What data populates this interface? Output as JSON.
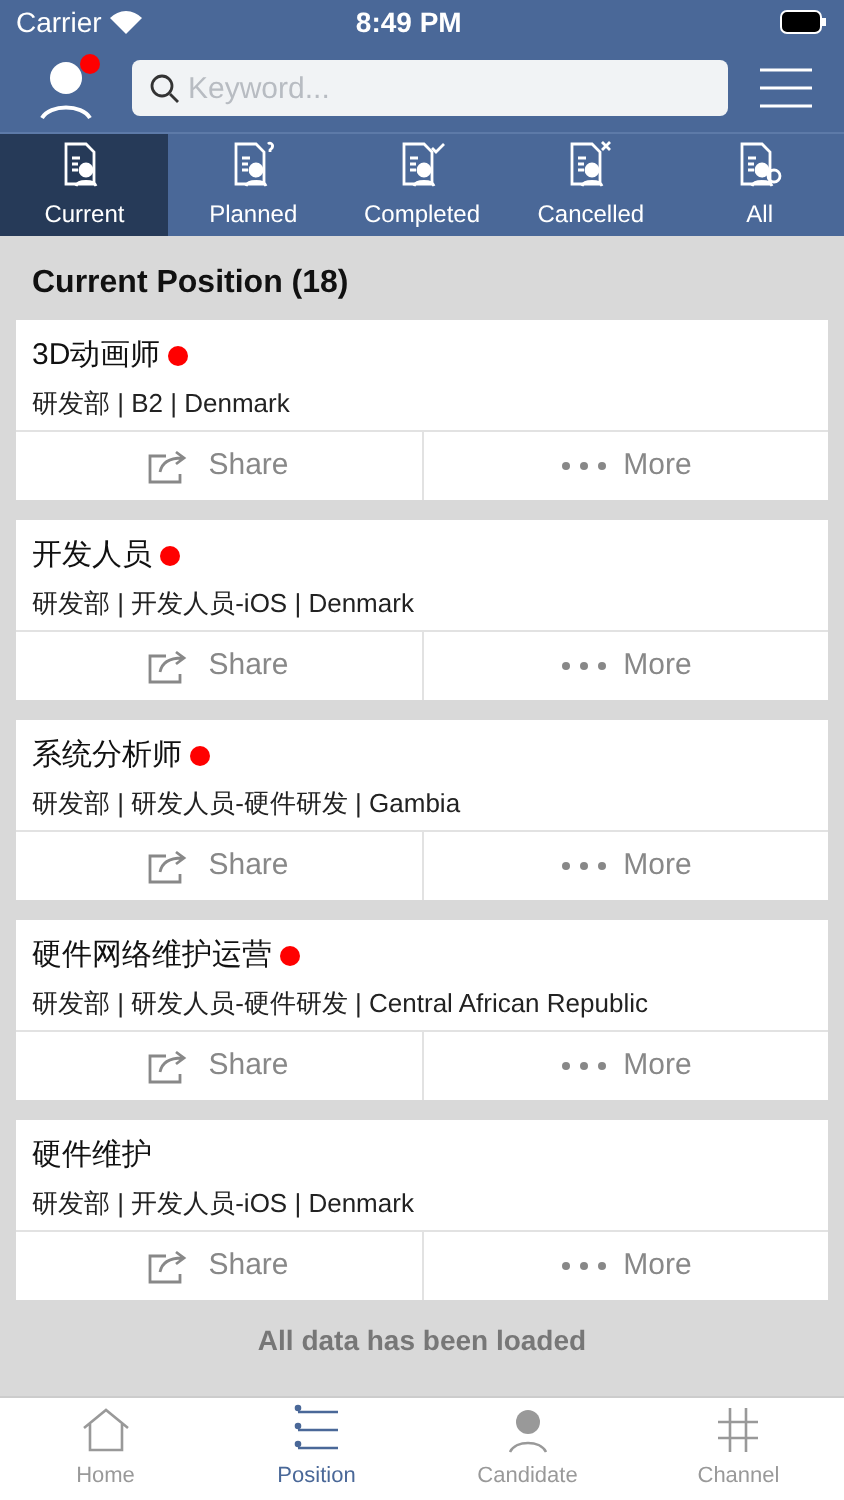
{
  "status_bar": {
    "carrier": "Carrier",
    "time": "8:49 PM"
  },
  "header": {
    "has_notification": true,
    "search": {
      "placeholder": "Keyword..."
    }
  },
  "tabs": [
    {
      "label": "Current",
      "selected": true
    },
    {
      "label": "Planned",
      "selected": false
    },
    {
      "label": "Completed",
      "selected": false
    },
    {
      "label": "Cancelled",
      "selected": false
    },
    {
      "label": "All",
      "selected": false
    }
  ],
  "section_title": "Current Position (18)",
  "positions": [
    {
      "title": "3D动画师",
      "unread": true,
      "details": "研发部 | B2 | Denmark",
      "share": "Share",
      "more": "More"
    },
    {
      "title": "开发人员",
      "unread": true,
      "details": "研发部 | 开发人员-iOS | Denmark",
      "share": "Share",
      "more": "More"
    },
    {
      "title": "系统分析师",
      "unread": true,
      "details": "研发部 | 研发人员-硬件研发 | Gambia",
      "share": "Share",
      "more": "More"
    },
    {
      "title": "硬件网络维护运营",
      "unread": true,
      "details": "研发部 | 研发人员-硬件研发 | Central African Republic",
      "share": "Share",
      "more": "More"
    },
    {
      "title": "硬件维护",
      "unread": false,
      "details": "研发部 | 开发人员-iOS | Denmark",
      "share": "Share",
      "more": "More"
    }
  ],
  "footer_note": "All data has been loaded",
  "bottom_nav": [
    {
      "label": "Home",
      "selected": false
    },
    {
      "label": "Position",
      "selected": true
    },
    {
      "label": "Candidate",
      "selected": false
    },
    {
      "label": "Channel",
      "selected": false
    }
  ]
}
